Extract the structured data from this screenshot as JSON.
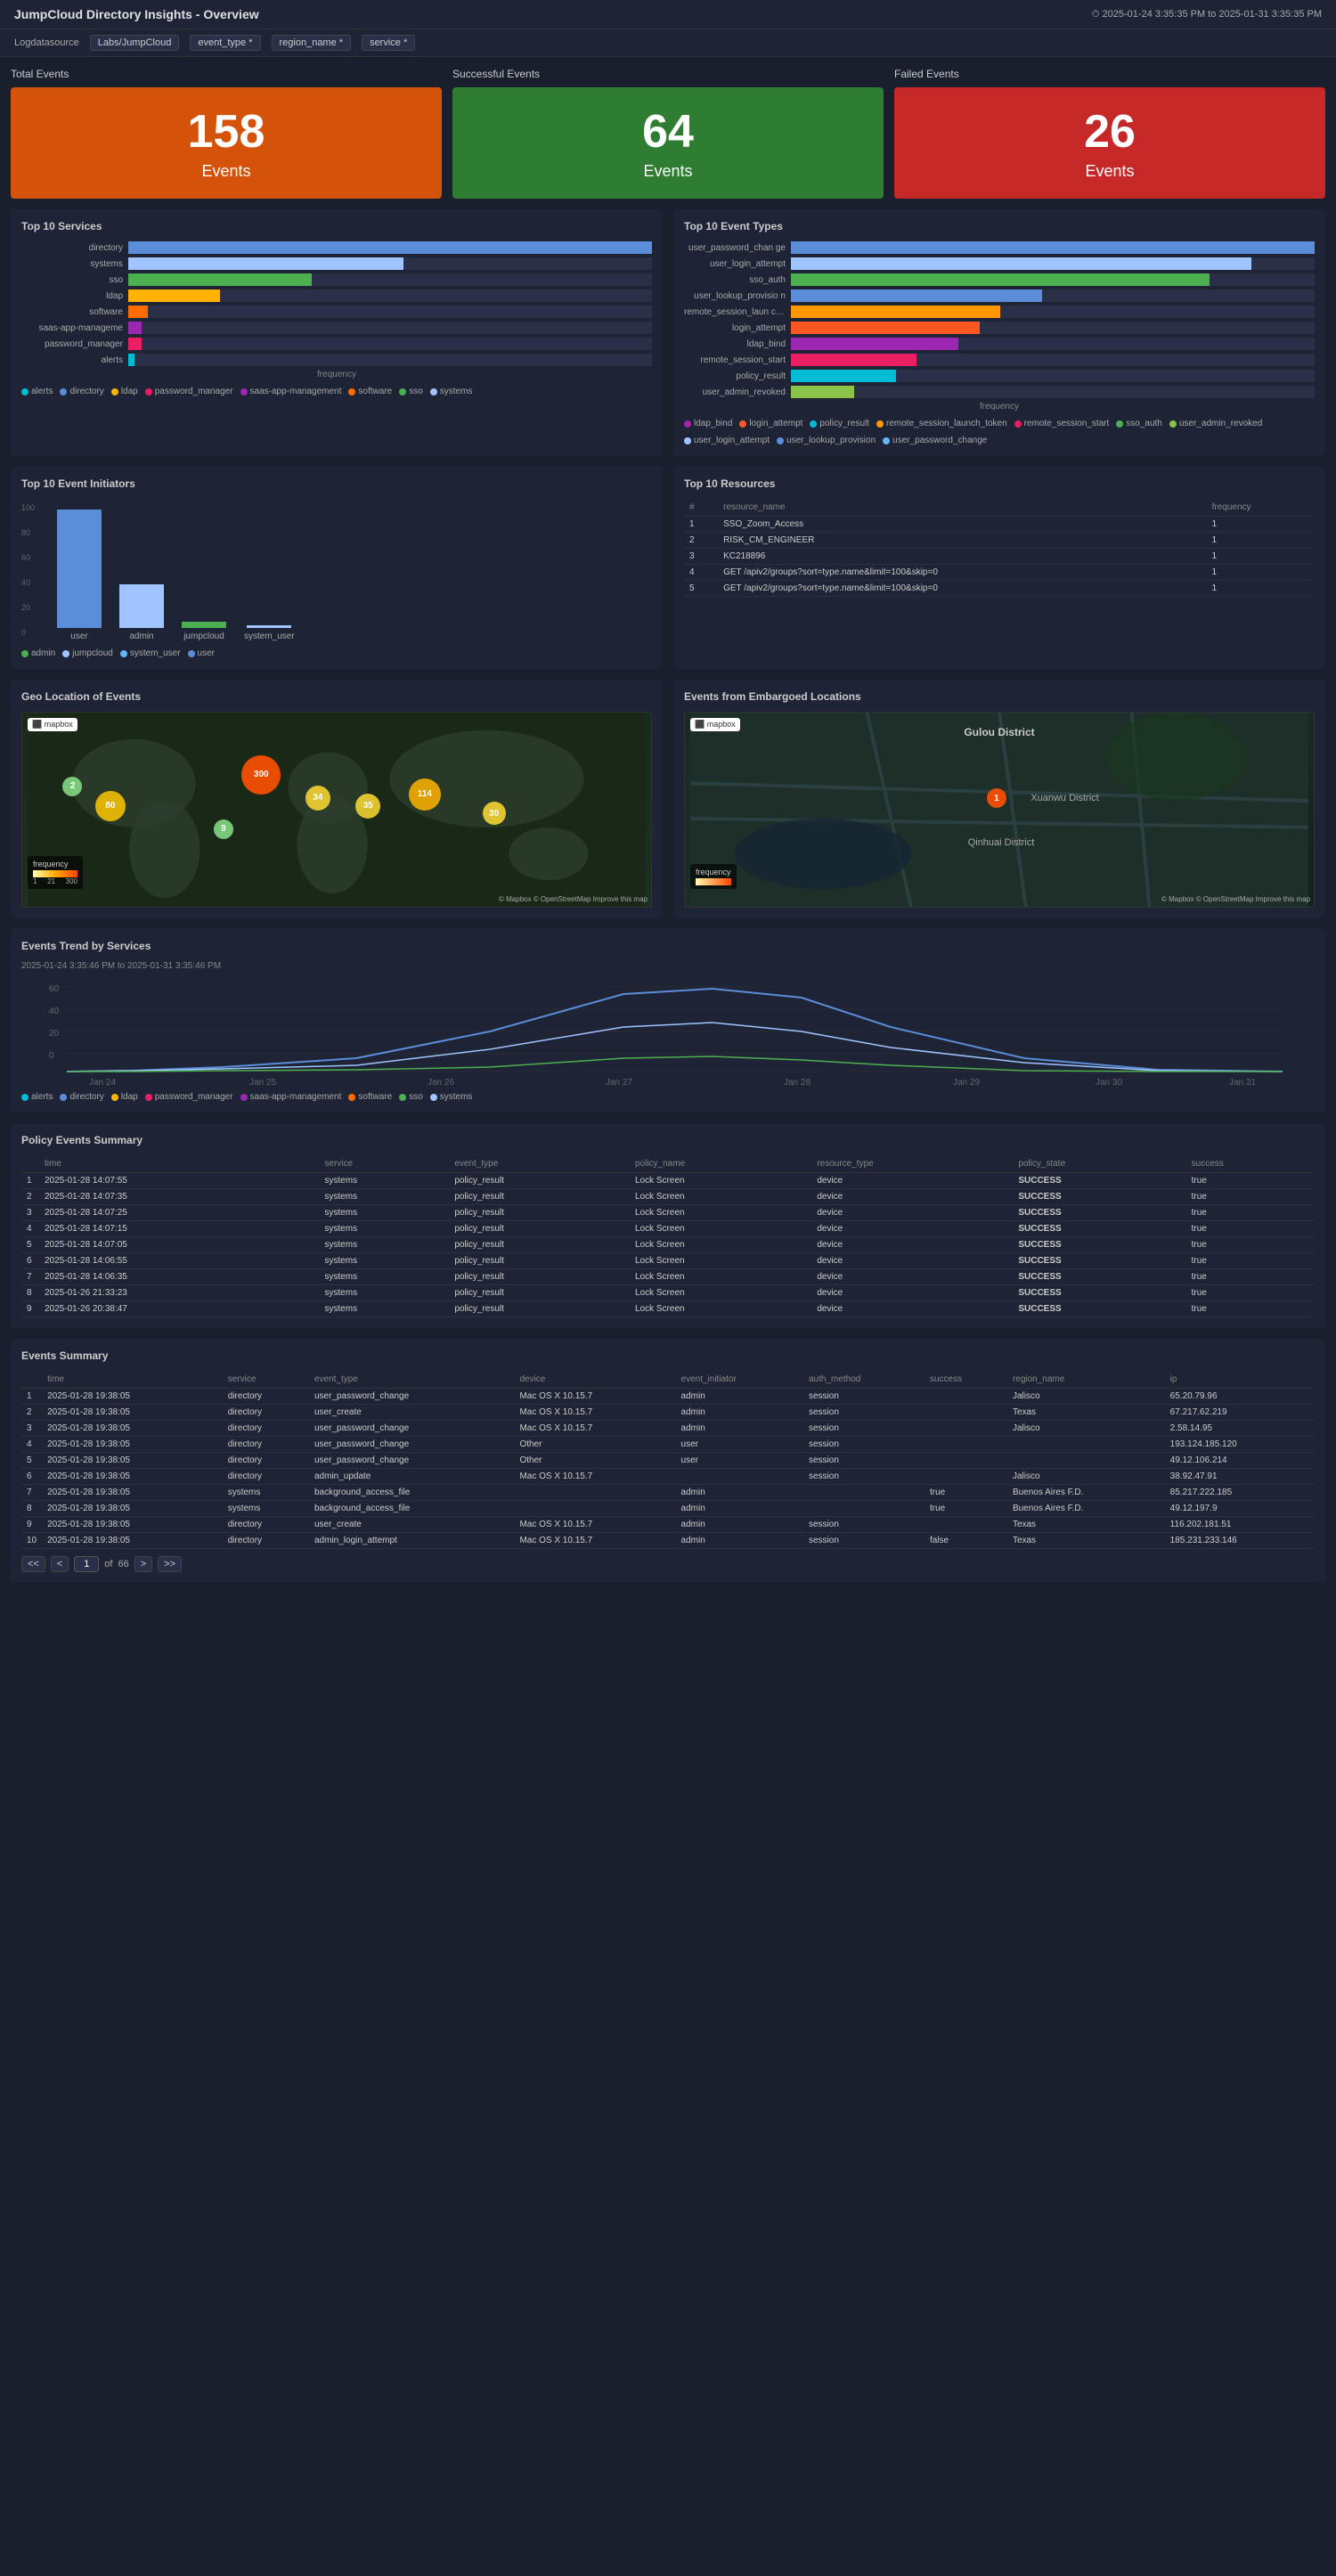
{
  "header": {
    "title": "JumpCloud Directory Insights - Overview",
    "time_range": "⏱ 2025-01-24 3:35:35 PM to 2025-01-31 3:35:35 PM"
  },
  "filters": {
    "log_datasource_label": "Logdatasource",
    "log_datasource_value": "Labs/JumpCloud",
    "event_type": "event_type *",
    "region_name": "region_name *",
    "service": "service *"
  },
  "kpis": {
    "total": {
      "label": "Total Events",
      "number": "158",
      "unit": "Events"
    },
    "successful": {
      "label": "Successful Events",
      "number": "64",
      "unit": "Events"
    },
    "failed": {
      "label": "Failed Events",
      "number": "26",
      "unit": "Events"
    }
  },
  "top10_services": {
    "title": "Top 10 Services",
    "x_label": "frequency",
    "bars": [
      {
        "label": "directory",
        "value": 80,
        "max": 80,
        "color": "#5b8dd9"
      },
      {
        "label": "systems",
        "value": 42,
        "max": 80,
        "color": "#a0c4ff"
      },
      {
        "label": "sso",
        "value": 28,
        "max": 80,
        "color": "#4caf50"
      },
      {
        "label": "ldap",
        "value": 14,
        "max": 80,
        "color": "#ffb300"
      },
      {
        "label": "software",
        "value": 3,
        "max": 80,
        "color": "#ff6d00"
      },
      {
        "label": "saas-app-manageme",
        "value": 2,
        "max": 80,
        "color": "#9c27b0"
      },
      {
        "label": "password_manager",
        "value": 2,
        "max": 80,
        "color": "#e91e63"
      },
      {
        "label": "alerts",
        "value": 1,
        "max": 80,
        "color": "#00bcd4"
      }
    ],
    "x_ticks": [
      "0",
      "10",
      "20",
      "30",
      "40",
      "50",
      "60",
      "70",
      "80"
    ],
    "legend": [
      {
        "label": "alerts",
        "color": "#00bcd4"
      },
      {
        "label": "directory",
        "color": "#5b8dd9"
      },
      {
        "label": "ldap",
        "color": "#ffb300"
      },
      {
        "label": "password_manager",
        "color": "#e91e63"
      },
      {
        "label": "saas-app-management",
        "color": "#9c27b0"
      },
      {
        "label": "software",
        "color": "#ff6d00"
      },
      {
        "label": "sso",
        "color": "#4caf50"
      },
      {
        "label": "systems",
        "color": "#a0c4ff"
      }
    ]
  },
  "top10_event_types": {
    "title": "Top 10 Event Types",
    "x_label": "frequency",
    "bars": [
      {
        "label": "user_password_chan ge",
        "value": 25,
        "max": 25,
        "color": "#5b8dd9"
      },
      {
        "label": "user_login_attempt",
        "value": 22,
        "max": 25,
        "color": "#a0c4ff"
      },
      {
        "label": "sso_auth",
        "value": 20,
        "max": 25,
        "color": "#4caf50"
      },
      {
        "label": "user_lookup_provisio n",
        "value": 12,
        "max": 25,
        "color": "#5b8dd9"
      },
      {
        "label": "remote_session_laun ch_token",
        "value": 10,
        "max": 25,
        "color": "#ff9800"
      },
      {
        "label": "login_attempt",
        "value": 9,
        "max": 25,
        "color": "#ff5722"
      },
      {
        "label": "ldap_bind",
        "value": 8,
        "max": 25,
        "color": "#9c27b0"
      },
      {
        "label": "remote_session_start",
        "value": 6,
        "max": 25,
        "color": "#e91e63"
      },
      {
        "label": "policy_result",
        "value": 5,
        "max": 25,
        "color": "#00bcd4"
      },
      {
        "label": "user_admin_revoked",
        "value": 3,
        "max": 25,
        "color": "#8bc34a"
      }
    ],
    "x_ticks": [
      "0",
      "5",
      "10",
      "15",
      "20",
      "25"
    ],
    "legend": [
      {
        "label": "ldap_bind",
        "color": "#9c27b0"
      },
      {
        "label": "login_attempt",
        "color": "#ff5722"
      },
      {
        "label": "policy_result",
        "color": "#00bcd4"
      },
      {
        "label": "remote_session_launch_token",
        "color": "#ff9800"
      },
      {
        "label": "remote_session_start",
        "color": "#e91e63"
      },
      {
        "label": "sso_auth",
        "color": "#4caf50"
      },
      {
        "label": "user_admin_revoked",
        "color": "#8bc34a"
      },
      {
        "label": "user_login_attempt",
        "color": "#a0c4ff"
      },
      {
        "label": "user_lookup_provision",
        "color": "#5b8dd9"
      },
      {
        "label": "user_password_change",
        "color": "#64b5f6"
      }
    ]
  },
  "top10_initiators": {
    "title": "Top 10 Event Initiators",
    "y_ticks": [
      "0",
      "20",
      "40",
      "60",
      "80",
      "100"
    ],
    "bars": [
      {
        "label": "user",
        "value": 95,
        "color": "#5b8dd9"
      },
      {
        "label": "admin",
        "value": 35,
        "color": "#a0c4ff"
      },
      {
        "label": "jumpcloud",
        "value": 5,
        "color": "#4caf50"
      },
      {
        "label": "system_user",
        "value": 2,
        "color": "#a0c4ff"
      }
    ],
    "legend": [
      {
        "label": "admin",
        "color": "#4caf50"
      },
      {
        "label": "jumpcloud",
        "color": "#a0c4ff"
      },
      {
        "label": "system_user",
        "color": "#64b5f6"
      },
      {
        "label": "user",
        "color": "#5b8dd9"
      }
    ]
  },
  "top10_resources": {
    "title": "Top 10 Resources",
    "columns": [
      "resource_name",
      "frequency"
    ],
    "rows": [
      {
        "num": "1",
        "name": "SSO_Zoom_Access",
        "freq": "1"
      },
      {
        "num": "2",
        "name": "RISK_CM_ENGINEER",
        "freq": "1"
      },
      {
        "num": "3",
        "name": "KC218896",
        "freq": "1"
      },
      {
        "num": "4",
        "name": "GET /apiv2/groups?sort=type.name&limit=100&skip=0",
        "freq": "1"
      },
      {
        "num": "5",
        "name": "GET /apiv2/groups?sort=type.name&limit=100&skip=0",
        "freq": "1"
      }
    ]
  },
  "geo_events": {
    "title": "Geo Location of Events",
    "bubbles": [
      {
        "label": "2",
        "x": 8,
        "y": 38,
        "size": 22,
        "color": "rgba(144,238,144,0.8)"
      },
      {
        "label": "80",
        "x": 14,
        "y": 48,
        "size": 34,
        "color": "rgba(255,200,0,0.85)"
      },
      {
        "label": "300",
        "x": 38,
        "y": 32,
        "size": 44,
        "color": "rgba(255,80,0,0.9)"
      },
      {
        "label": "34",
        "x": 47,
        "y": 44,
        "size": 28,
        "color": "rgba(255,220,50,0.85)"
      },
      {
        "label": "35",
        "x": 55,
        "y": 48,
        "size": 28,
        "color": "rgba(255,220,50,0.85)"
      },
      {
        "label": "114",
        "x": 64,
        "y": 42,
        "size": 36,
        "color": "rgba(255,180,0,0.85)"
      },
      {
        "label": "9",
        "x": 32,
        "y": 60,
        "size": 22,
        "color": "rgba(144,238,144,0.8)"
      },
      {
        "label": "30",
        "x": 75,
        "y": 52,
        "size": 26,
        "color": "rgba(255,220,50,0.85)"
      }
    ],
    "legend_label": "frequency"
  },
  "embargoed_events": {
    "title": "Events from Embargoed Locations",
    "city_label": "Gulou District",
    "district1": "Xuanwu District",
    "district2": "Qinhuai District",
    "bubble": {
      "label": "1",
      "color": "rgba(255,80,0,0.9)"
    }
  },
  "events_trend": {
    "title": "Events Trend by Services",
    "subtitle": "2025-01-24 3:35:46 PM to 2025-01-31 3:35:46 PM",
    "x_labels": [
      "Jan 24",
      "Jan 25",
      "Jan 26",
      "Jan 27",
      "Jan 28",
      "Jan 29",
      "Jan 30",
      "Jan 31"
    ],
    "legend": [
      {
        "label": "alerts",
        "color": "#00bcd4"
      },
      {
        "label": "directory",
        "color": "#5b8dd9"
      },
      {
        "label": "ldap",
        "color": "#ffb300"
      },
      {
        "label": "password_manager",
        "color": "#e91e63"
      },
      {
        "label": "saas-app-management",
        "color": "#9c27b0"
      },
      {
        "label": "software",
        "color": "#ff6d00"
      },
      {
        "label": "sso",
        "color": "#4caf50"
      },
      {
        "label": "systems",
        "color": "#a0c4ff"
      }
    ]
  },
  "policy_summary": {
    "title": "Policy Events Summary",
    "columns": [
      "",
      "time",
      "service",
      "event_type",
      "policy_name",
      "resource_type",
      "policy_state",
      "success"
    ],
    "rows": [
      {
        "num": "1",
        "time": "2025-01-28 14:07:55",
        "service": "systems",
        "event_type": "policy_result",
        "policy_name": "Lock Screen",
        "resource_type": "device",
        "policy_state": "SUCCESS",
        "success": "true"
      },
      {
        "num": "2",
        "time": "2025-01-28 14:07:35",
        "service": "systems",
        "event_type": "policy_result",
        "policy_name": "Lock Screen",
        "resource_type": "device",
        "policy_state": "SUCCESS",
        "success": "true"
      },
      {
        "num": "3",
        "time": "2025-01-28 14:07:25",
        "service": "systems",
        "event_type": "policy_result",
        "policy_name": "Lock Screen",
        "resource_type": "device",
        "policy_state": "SUCCESS",
        "success": "true"
      },
      {
        "num": "4",
        "time": "2025-01-28 14:07:15",
        "service": "systems",
        "event_type": "policy_result",
        "policy_name": "Lock Screen",
        "resource_type": "device",
        "policy_state": "SUCCESS",
        "success": "true"
      },
      {
        "num": "5",
        "time": "2025-01-28 14:07:05",
        "service": "systems",
        "event_type": "policy_result",
        "policy_name": "Lock Screen",
        "resource_type": "device",
        "policy_state": "SUCCESS",
        "success": "true"
      },
      {
        "num": "6",
        "time": "2025-01-28 14:06:55",
        "service": "systems",
        "event_type": "policy_result",
        "policy_name": "Lock Screen",
        "resource_type": "device",
        "policy_state": "SUCCESS",
        "success": "true"
      },
      {
        "num": "7",
        "time": "2025-01-28 14:06:35",
        "service": "systems",
        "event_type": "policy_result",
        "policy_name": "Lock Screen",
        "resource_type": "device",
        "policy_state": "SUCCESS",
        "success": "true"
      },
      {
        "num": "8",
        "time": "2025-01-26 21:33:23",
        "service": "systems",
        "event_type": "policy_result",
        "policy_name": "Lock Screen",
        "resource_type": "device",
        "policy_state": "SUCCESS",
        "success": "true"
      },
      {
        "num": "9",
        "time": "2025-01-26 20:38:47",
        "service": "systems",
        "event_type": "policy_result",
        "policy_name": "Lock Screen",
        "resource_type": "device",
        "policy_state": "SUCCESS",
        "success": "true"
      }
    ]
  },
  "events_summary": {
    "title": "Events Summary",
    "columns": [
      "",
      "time",
      "service",
      "event_type",
      "device",
      "event_initiator",
      "auth_method",
      "success",
      "region_name",
      "ip"
    ],
    "rows": [
      {
        "num": "1",
        "time": "2025-01-28 19:38:05",
        "service": "directory",
        "event_type": "user_password_change",
        "device": "Mac OS X 10.15.7",
        "event_initiator": "admin",
        "auth_method": "session",
        "success": "",
        "region_name": "Jalisco",
        "ip": "65.20.79.96"
      },
      {
        "num": "2",
        "time": "2025-01-28 19:38:05",
        "service": "directory",
        "event_type": "user_create",
        "device": "Mac OS X 10.15.7",
        "event_initiator": "admin",
        "auth_method": "session",
        "success": "",
        "region_name": "Texas",
        "ip": "67.217.62.219"
      },
      {
        "num": "3",
        "time": "2025-01-28 19:38:05",
        "service": "directory",
        "event_type": "user_password_change",
        "device": "Mac OS X 10.15.7",
        "event_initiator": "admin",
        "auth_method": "session",
        "success": "",
        "region_name": "Jalisco",
        "ip": "2.58.14.95"
      },
      {
        "num": "4",
        "time": "2025-01-28 19:38:05",
        "service": "directory",
        "event_type": "user_password_change",
        "device": "Other",
        "event_initiator": "user",
        "auth_method": "session",
        "success": "",
        "region_name": "",
        "ip": "193.124.185.120"
      },
      {
        "num": "5",
        "time": "2025-01-28 19:38:05",
        "service": "directory",
        "event_type": "user_password_change",
        "device": "Other",
        "event_initiator": "user",
        "auth_method": "session",
        "success": "",
        "region_name": "",
        "ip": "49.12.106.214"
      },
      {
        "num": "6",
        "time": "2025-01-28 19:38:05",
        "service": "directory",
        "event_type": "admin_update",
        "device": "Mac OS X 10.15.7",
        "event_initiator": "",
        "auth_method": "session",
        "success": "",
        "region_name": "Jalisco",
        "ip": "38.92.47.91"
      },
      {
        "num": "7",
        "time": "2025-01-28 19:38:05",
        "service": "systems",
        "event_type": "background_access_file",
        "device": "",
        "event_initiator": "admin",
        "auth_method": "",
        "success": "true",
        "region_name": "Buenos Aires F.D.",
        "ip": "85.217.222.185"
      },
      {
        "num": "8",
        "time": "2025-01-28 19:38:05",
        "service": "systems",
        "event_type": "background_access_file",
        "device": "",
        "event_initiator": "admin",
        "auth_method": "",
        "success": "true",
        "region_name": "Buenos Aires F.D.",
        "ip": "49.12.197.9"
      },
      {
        "num": "9",
        "time": "2025-01-28 19:38:05",
        "service": "directory",
        "event_type": "user_create",
        "device": "Mac OS X 10.15.7",
        "event_initiator": "admin",
        "auth_method": "session",
        "success": "",
        "region_name": "Texas",
        "ip": "116.202.181.51"
      },
      {
        "num": "10",
        "time": "2025-01-28 19:38:05",
        "service": "directory",
        "event_type": "admin_login_attempt",
        "device": "Mac OS X 10.15.7",
        "event_initiator": "admin",
        "auth_method": "session",
        "success": "false",
        "region_name": "Texas",
        "ip": "185.231.233.146"
      }
    ],
    "pagination": {
      "current": "1",
      "total": "66",
      "prev": "<",
      "next": ">",
      "first": "<<",
      "last": ">>"
    }
  }
}
